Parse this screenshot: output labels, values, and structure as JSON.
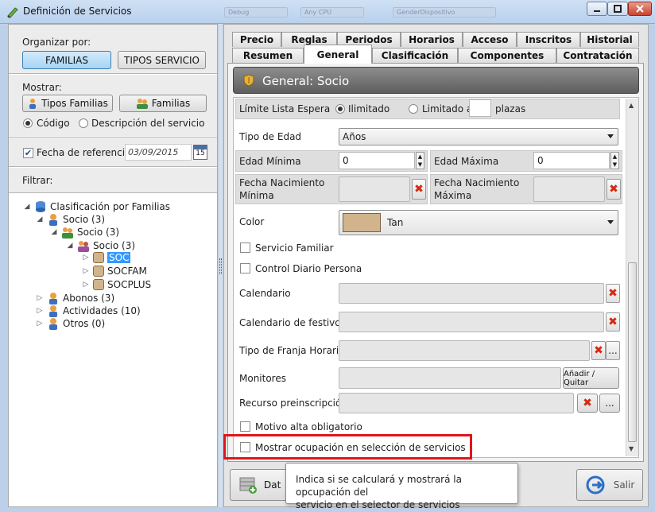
{
  "window": {
    "title": "Definición de Servicios",
    "ghost_fields": [
      "Debug",
      "Any CPU",
      "GenderDispositivo"
    ]
  },
  "left": {
    "organize_label": "Organizar por:",
    "btn_familias": "FAMILIAS",
    "btn_tipos": "TIPOS SERVICIO",
    "mostrar_label": "Mostrar:",
    "btn_tipos_familias": "Tipos Familias",
    "btn_familias2": "Familias",
    "radio_codigo": "Código",
    "radio_descripcion": "Descripción del servicio",
    "fecha_label": "Fecha de referencia:",
    "fecha_value": "03/09/2015",
    "calendar_day": "15",
    "filtrar_label": "Filtrar:",
    "tree": {
      "root": "Clasificación por Familias",
      "socio1": "Socio (3)",
      "socio2": "Socio (3)",
      "socio3": "Socio (3)",
      "soc": "SOC",
      "socfam": "SOCFAM",
      "socplus": "SOCPLUS",
      "abonos": "Abonos (3)",
      "actividades": "Actividades (10)",
      "otros": "Otros (0)"
    }
  },
  "tabs_top": [
    "Precio",
    "Reglas",
    "Periodos",
    "Horarios",
    "Acceso",
    "Inscritos",
    "Historial"
  ],
  "tabs_bottom": [
    "Resumen",
    "General",
    "Clasificación",
    "Componentes",
    "Contratación"
  ],
  "active_tab": "General",
  "header_title": "General: Socio",
  "form": {
    "limite_label": "Límite Lista Espera",
    "ilimitado": "Ilimitado",
    "limitado": "Limitado a",
    "plazas": "plazas",
    "tipo_edad_label": "Tipo de Edad",
    "tipo_edad_value": "Años",
    "edad_min_label": "Edad Mínima",
    "edad_min_value": "0",
    "edad_max_label": "Edad Máxima",
    "edad_max_value": "0",
    "fecha_nac_min_l1": "Fecha Nacimiento",
    "fecha_nac_min_l2": "Mínima",
    "fecha_nac_max_l1": "Fecha Nacimiento",
    "fecha_nac_max_l2": "Máxima",
    "color_label": "Color",
    "color_value": "Tan",
    "color_hex": "#D2B48C",
    "servicio_familiar": "Servicio Familiar",
    "control_diario": "Control Diario Persona",
    "calendario": "Calendario",
    "calendario_festivos": "Calendario de festivos",
    "tipo_franja": "Tipo de Franja Horaria",
    "monitores": "Monitores",
    "anadir_quitar": "Añadir / Quitar",
    "recurso": "Recurso preinscripción",
    "motivo": "Motivo alta obligatorio",
    "mostrar_ocupacion": "Mostrar ocupación en selección de servicios",
    "ellipsis": "..."
  },
  "footer": {
    "btn_datos": "Dat",
    "btn_salir": "Salir"
  },
  "tooltip": {
    "line1": "Indica si se calculará y mostrará la opcupación del",
    "line2": "servicio en el selector de servicios"
  }
}
